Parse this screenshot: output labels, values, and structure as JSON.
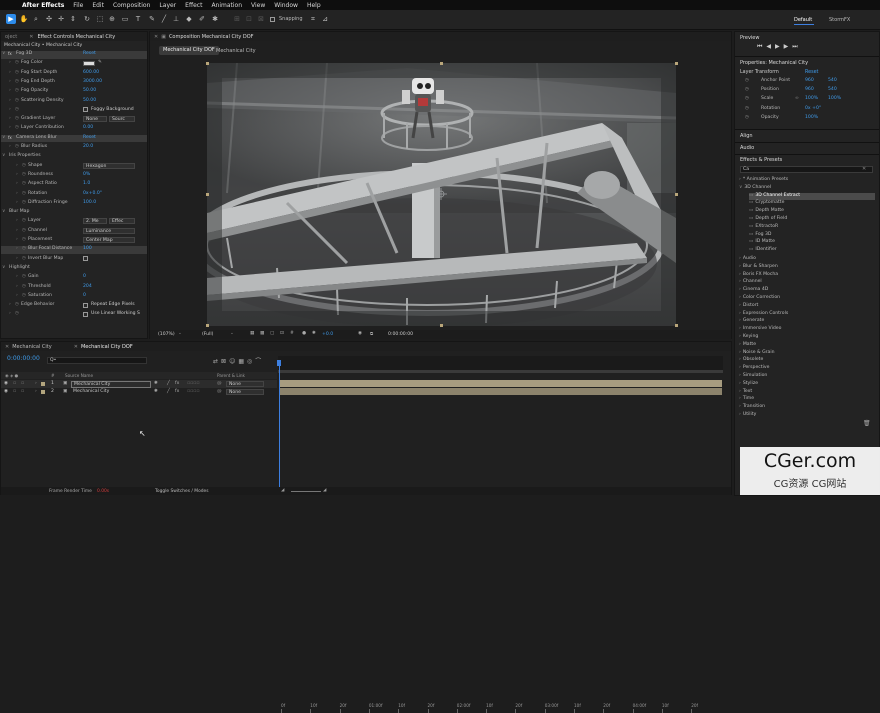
{
  "menubar": {
    "app": "After Effects",
    "items": [
      "File",
      "Edit",
      "Composition",
      "Layer",
      "Effect",
      "Animation",
      "View",
      "Window",
      "Help"
    ]
  },
  "toolbar": {
    "snapping": "Snapping",
    "workspaces": [
      "Default",
      "StormFX"
    ]
  },
  "effect_controls": {
    "partial_tab": "oject",
    "tab": "Effect Controls Mechanical City",
    "subtitle": "Mechanical City • Mechanical City",
    "rows": [
      {
        "t": "fx",
        "label": "Fog 3D",
        "val": "Reset",
        "indent": 0,
        "hl": true
      },
      {
        "t": "color",
        "label": "Fog Color",
        "indent": 1
      },
      {
        "t": "val",
        "label": "Fog Start Depth",
        "val": "600.00",
        "indent": 1
      },
      {
        "t": "val",
        "label": "Fog End Depth",
        "val": "3000.00",
        "indent": 1
      },
      {
        "t": "val",
        "label": "Fog Opacity",
        "val": "50.00",
        "indent": 1
      },
      {
        "t": "val",
        "label": "Scattering Density",
        "val": "50.00",
        "indent": 1
      },
      {
        "t": "cb",
        "label": "",
        "val": "Foggy Background",
        "indent": 1
      },
      {
        "t": "dd2",
        "label": "Gradient Layer",
        "val": "None",
        "val2": "Sourc",
        "indent": 1
      },
      {
        "t": "val",
        "label": "Layer Contribution",
        "val": "0.00",
        "indent": 1
      },
      {
        "t": "fx",
        "label": "Camera Lens Blur",
        "val": "Reset",
        "indent": 0,
        "hl": true
      },
      {
        "t": "val",
        "label": "Blur Radius",
        "val": "20.0",
        "indent": 1
      },
      {
        "t": "grp",
        "label": "Iris Properties",
        "indent": 0
      },
      {
        "t": "dd",
        "label": "Shape",
        "val": "Hexagon",
        "indent": 2
      },
      {
        "t": "val",
        "label": "Roundness",
        "val": "0%",
        "indent": 2
      },
      {
        "t": "val",
        "label": "Aspect Ratio",
        "val": "1.0",
        "indent": 2
      },
      {
        "t": "val",
        "label": "Rotation",
        "val": "0x+0.0°",
        "indent": 2
      },
      {
        "t": "val",
        "label": "Diffraction Fringe",
        "val": "100.0",
        "indent": 2
      },
      {
        "t": "grp",
        "label": "Blur Map",
        "indent": 0
      },
      {
        "t": "dd2",
        "label": "Layer",
        "val": "2. Me",
        "val2": "Effec",
        "indent": 2
      },
      {
        "t": "dd",
        "label": "Channel",
        "val": "Luminance",
        "indent": 2
      },
      {
        "t": "dd",
        "label": "Placement",
        "val": "Center Map",
        "indent": 2
      },
      {
        "t": "val",
        "label": "Blur Focal Distance",
        "val": "100",
        "indent": 2,
        "hl": true
      },
      {
        "t": "cb",
        "label": "Invert Blur Map",
        "val": "",
        "indent": 2
      },
      {
        "t": "grp",
        "label": "Highlight",
        "indent": 0
      },
      {
        "t": "val",
        "label": "Gain",
        "val": "0",
        "indent": 2
      },
      {
        "t": "val",
        "label": "Threshold",
        "val": "204",
        "indent": 2
      },
      {
        "t": "val",
        "label": "Saturation",
        "val": "0",
        "indent": 2
      },
      {
        "t": "cb",
        "label": "Edge Behavior",
        "val": "Repeat Edge Pixels",
        "indent": 1
      },
      {
        "t": "cb",
        "label": "",
        "val": "Use Linear Working S",
        "indent": 1
      }
    ]
  },
  "composition": {
    "tab": "Composition Mechanical City DOF",
    "subtabs": [
      "Mechanical City DOF",
      "Mechanical City"
    ],
    "zoom": "(107%)",
    "resolution": "(Full)",
    "exposure": "+0.0",
    "timecode": "0:00:00:00"
  },
  "preview": {
    "title": "Preview"
  },
  "properties": {
    "title": "Properties: Mechanical City",
    "section": "Layer Transform",
    "reset": "Reset",
    "rows": [
      {
        "label": "Anchor Point",
        "v1": "960",
        "v2": "540"
      },
      {
        "label": "Position",
        "v1": "960",
        "v2": "540"
      },
      {
        "label": "Scale",
        "v1": "100%",
        "v2": "100%"
      },
      {
        "label": "Rotation",
        "v1": "0x +0°",
        "v2": ""
      },
      {
        "label": "Opacity",
        "v1": "100%",
        "v2": ""
      }
    ]
  },
  "align": {
    "title": "Align"
  },
  "audio": {
    "title": "Audio"
  },
  "effects_presets": {
    "title": "Effects & Presets",
    "search": "Ca",
    "top": [
      "* Animation Presets",
      "3D Channel"
    ],
    "channel3d": [
      "3D Channel Extract",
      "Cryptomatte",
      "Depth Matte",
      "Depth of Field",
      "EXtractoR",
      "Fog 3D",
      "ID Matte",
      "IDentifier"
    ],
    "categories": [
      "Audio",
      "Blur & Sharpen",
      "Boris FX Mocha",
      "Channel",
      "Cinema 4D",
      "Color Correction",
      "Distort",
      "Expression Controls",
      "Generate",
      "Immersive Video",
      "Keying",
      "Matte",
      "Noise & Grain",
      "Obsolete",
      "Perspective",
      "Simulation",
      "Stylize",
      "Text",
      "Time",
      "Transition",
      "Utility"
    ]
  },
  "timeline": {
    "tabs": [
      "Mechanical City",
      "Mechanical City DOF"
    ],
    "timecode": "0:00:00:00",
    "search": "Q•",
    "headers": {
      "num": "#",
      "source": "Source Name",
      "parent": "Parent & Link"
    },
    "layers": [
      {
        "num": "1",
        "name": "Mechanical City",
        "parent": "None"
      },
      {
        "num": "2",
        "name": "Mechanical City",
        "parent": "None"
      }
    ],
    "ruler": [
      "0f",
      "10f",
      "20f",
      "01:00f",
      "10f",
      "20f",
      "02:00f",
      "10f",
      "20f",
      "03:00f",
      "10f",
      "20f",
      "04:00f",
      "10f",
      "20f"
    ],
    "footer": {
      "render_label": "Frame Render Time",
      "render_value": "0.00s",
      "toggle": "Toggle Switches / Modes"
    }
  },
  "watermark": {
    "big": "CGer.com",
    "small": "CG资源 CG网站"
  },
  "colors": {
    "accent": "#2d8ceb",
    "value_blue": "#3f9bea",
    "layer_bar": "#a79c80",
    "playhead": "#3d7fe0"
  }
}
